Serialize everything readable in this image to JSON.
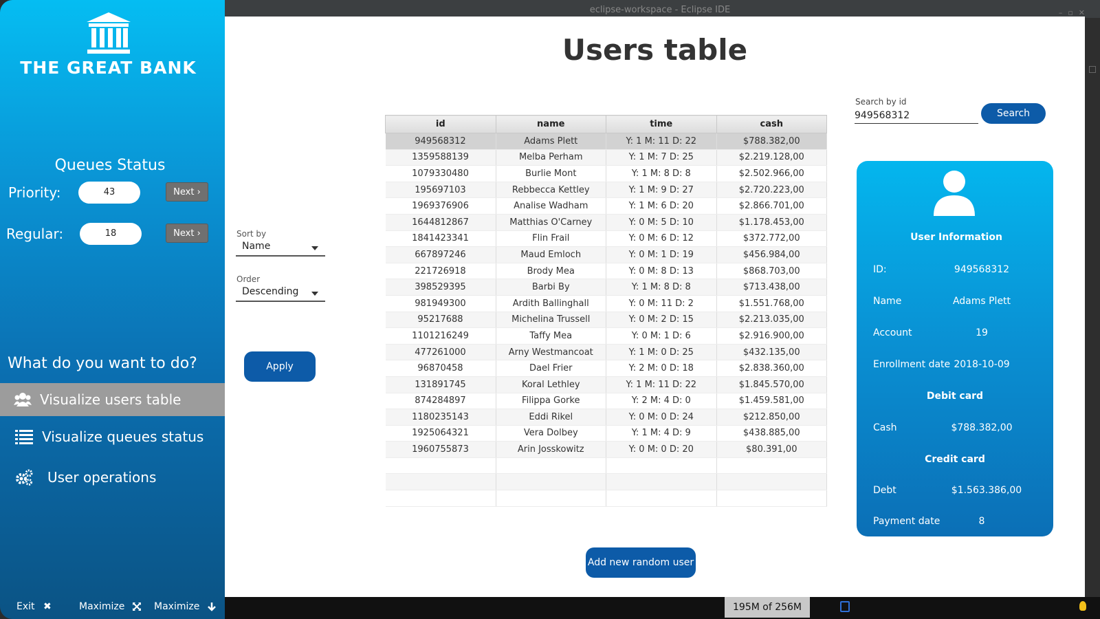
{
  "window": {
    "title": "eclipse-workspace - Eclipse IDE",
    "heap": "195M of 256M"
  },
  "sidebar": {
    "brand": "THE GREAT BANK",
    "queues_title": "Queues Status",
    "priority": {
      "label": "Priority:",
      "value": "43",
      "next": "Next"
    },
    "regular": {
      "label": "Regular:",
      "value": "18",
      "next": "Next"
    },
    "prompt": "What do you want to do?",
    "nav": [
      {
        "label": "Visualize users table",
        "icon": "users-icon",
        "active": true
      },
      {
        "label": "Visualize queues status",
        "icon": "list-icon",
        "active": false
      },
      {
        "label": "User operations",
        "icon": "gears-icon",
        "active": false
      }
    ],
    "bottom": {
      "exit": "Exit",
      "maximize": "Maximize",
      "minimize": "Maximize"
    }
  },
  "main": {
    "title": "Users table",
    "sort_by": {
      "label": "Sort by",
      "value": "Name"
    },
    "order": {
      "label": "Order",
      "value": "Descending"
    },
    "apply": "Apply",
    "add_user": "Add new random user",
    "search": {
      "label": "Search by id",
      "value": "949568312",
      "button": "Search"
    }
  },
  "table": {
    "columns": [
      "id",
      "name",
      "time",
      "cash"
    ],
    "rows": [
      [
        "949568312",
        "Adams Plett",
        "Y: 1 M: 11 D: 22",
        "$788.382,00"
      ],
      [
        "1359588139",
        "Melba Perham",
        "Y: 1 M: 7 D: 25",
        "$2.219.128,00"
      ],
      [
        "1079330480",
        "Burlie Mont",
        "Y: 1 M: 8 D: 8",
        "$2.502.966,00"
      ],
      [
        "195697103",
        "Rebbecca Kettley",
        "Y: 1 M: 9 D: 27",
        "$2.720.223,00"
      ],
      [
        "1969376906",
        "Analise Wadham",
        "Y: 1 M: 6 D: 20",
        "$2.866.701,00"
      ],
      [
        "1644812867",
        "Matthias O'Carney",
        "Y: 0 M: 5 D: 10",
        "$1.178.453,00"
      ],
      [
        "1841423341",
        "Flin Frail",
        "Y: 0 M: 6 D: 12",
        "$372.772,00"
      ],
      [
        "667897246",
        "Maud Emloch",
        "Y: 0 M: 1 D: 19",
        "$456.984,00"
      ],
      [
        "221726918",
        "Brody Mea",
        "Y: 0 M: 8 D: 13",
        "$868.703,00"
      ],
      [
        "398529395",
        "Barbi By",
        "Y: 1 M: 8 D: 8",
        "$713.438,00"
      ],
      [
        "981949300",
        "Ardith Ballinghall",
        "Y: 0 M: 11 D: 2",
        "$1.551.768,00"
      ],
      [
        "95217688",
        "Michelina Trussell",
        "Y: 0 M: 2 D: 15",
        "$2.213.035,00"
      ],
      [
        "1101216249",
        "Taffy Mea",
        "Y: 0 M: 1 D: 6",
        "$2.916.900,00"
      ],
      [
        "477261000",
        "Arny Westmancoat",
        "Y: 1 M: 0 D: 25",
        "$432.135,00"
      ],
      [
        "96870458",
        "Dael Frier",
        "Y: 2 M: 0 D: 18",
        "$2.838.360,00"
      ],
      [
        "131891745",
        "Koral Lethley",
        "Y: 1 M: 11 D: 22",
        "$1.845.570,00"
      ],
      [
        "874284897",
        "Filippa Gorke",
        "Y: 2 M: 4 D: 0",
        "$1.459.581,00"
      ],
      [
        "1180235143",
        "Eddi Rikel",
        "Y: 0 M: 0 D: 24",
        "$212.850,00"
      ],
      [
        "1925064321",
        "Vera Dolbey",
        "Y: 1 M: 4 D: 9",
        "$438.885,00"
      ],
      [
        "1960755873",
        "Arin Josskowitz",
        "Y: 0 M: 0 D: 20",
        "$80.391,00"
      ]
    ],
    "selected_row": 0
  },
  "user_info": {
    "title": "User Information",
    "id_label": "ID:",
    "id": "949568312",
    "name_label": "Name",
    "name": "Adams Plett",
    "account_label": "Account",
    "account": "19",
    "enrollment_label": "Enrollment date",
    "enrollment": "2018-10-09",
    "debit_title": "Debit card",
    "cash_label": "Cash",
    "cash": "$788.382,00",
    "credit_title": "Credit card",
    "debt_label": "Debt",
    "debt": "$1.563.386,00",
    "payment_label": "Payment date",
    "payment": "8"
  },
  "colors": {
    "accent": "#0d5ba8",
    "sidebar_top": "#05bdf2",
    "sidebar_bottom": "#0b5384",
    "selection": "#d2d2d2"
  }
}
